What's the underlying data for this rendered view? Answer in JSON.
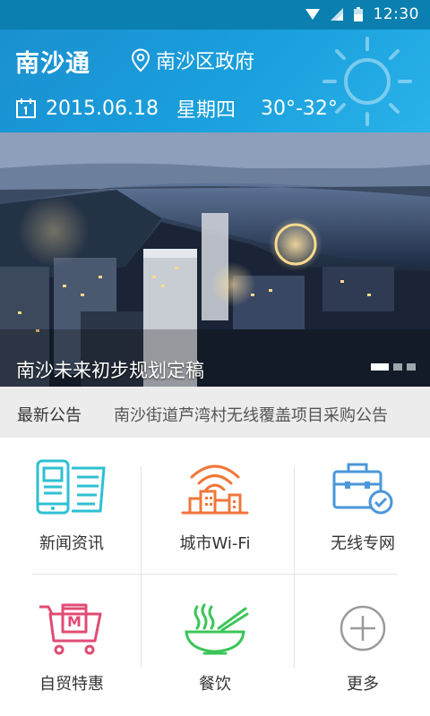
{
  "status_bar": {
    "time": "12:30"
  },
  "header": {
    "app_title": "南沙通",
    "location": "南沙区政府",
    "date": "2015.06.18",
    "weekday": "星期四",
    "temperature": "30°-32°",
    "weather_icon": "sun-icon"
  },
  "banner": {
    "caption": "南沙未来初步规划定稿",
    "page_count": 3,
    "active_page": 1
  },
  "notice": {
    "label": "最新公告",
    "text": "南沙街道芦湾村无线覆盖项目采购公告"
  },
  "menu": [
    {
      "label": "新闻资讯",
      "icon": "news-icon",
      "color": "#2ec0d3"
    },
    {
      "label": "城市Wi-Fi",
      "icon": "city-wifi-icon",
      "color": "#f0773a"
    },
    {
      "label": "无线专网",
      "icon": "briefcase-check-icon",
      "color": "#4a97d9"
    },
    {
      "label": "自贸特惠",
      "icon": "shopping-cart-icon",
      "color": "#e14b74"
    },
    {
      "label": "餐饮",
      "icon": "noodle-bowl-icon",
      "color": "#3cc559"
    },
    {
      "label": "更多",
      "icon": "plus-circle-icon",
      "color": "#9a9a9a"
    }
  ]
}
